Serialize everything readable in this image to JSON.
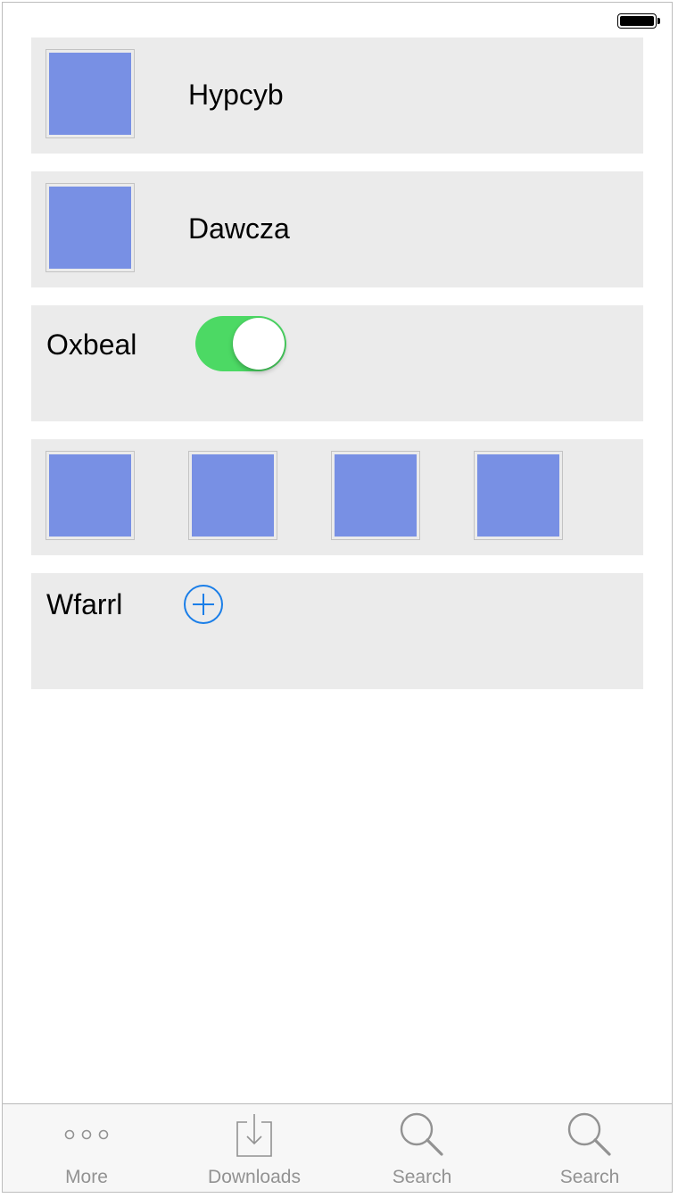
{
  "status_bar": {
    "battery_icon": "battery-full-icon"
  },
  "cells": {
    "row1": {
      "title": "Hypcyb",
      "thumb_color": "#7890e4"
    },
    "row2": {
      "title": "Dawcza",
      "thumb_color": "#7890e4"
    },
    "row3": {
      "title": "Oxbeal",
      "toggle_on": true,
      "toggle_color": "#4cd964"
    },
    "row4": {
      "thumb_count": 4,
      "thumb_color": "#7890e4"
    },
    "row5": {
      "title": "Wfarrl",
      "add_icon": "plus-circle-icon",
      "accent": "#1a7ee8"
    }
  },
  "tab_bar": {
    "tabs": [
      {
        "label": "More",
        "icon": "more-dots-icon"
      },
      {
        "label": "Downloads",
        "icon": "download-tray-icon"
      },
      {
        "label": "Search",
        "icon": "search-icon"
      },
      {
        "label": "Search",
        "icon": "search-icon"
      }
    ],
    "label_color": "#929292"
  }
}
